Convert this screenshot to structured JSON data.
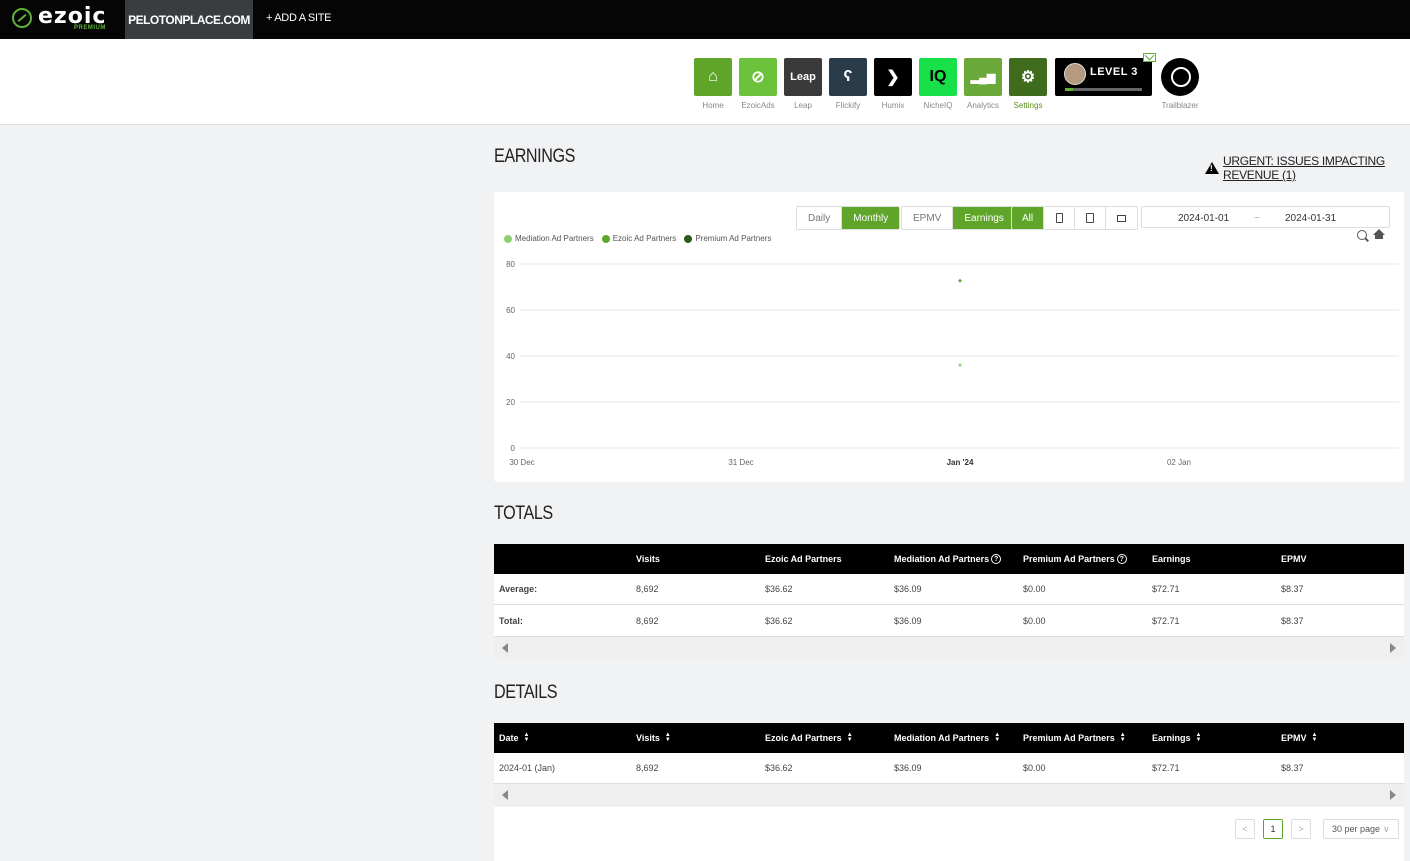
{
  "topbar": {
    "logo_text": "ezoic",
    "logo_sub": "PREMIUM",
    "site_name": "PELOTONPLACE.COM",
    "add_site": "+ ADD A SITE"
  },
  "apps": [
    {
      "label": "Home",
      "icon": "home-icon",
      "color": "#5fa52a",
      "glyph": "⌂"
    },
    {
      "label": "EzoicAds",
      "icon": "ezoicads-icon",
      "color": "#6cc23a",
      "glyph": "⊘"
    },
    {
      "label": "Leap",
      "icon": "leap-icon",
      "color": "#3a3a3a",
      "glyph": "Leap"
    },
    {
      "label": "Flickify",
      "icon": "flickify-icon",
      "color": "#2a3b4a",
      "glyph": "ʕ"
    },
    {
      "label": "Humix",
      "icon": "humix-icon",
      "color": "#000000",
      "glyph": "❯"
    },
    {
      "label": "NicheIQ",
      "icon": "nicheiq-icon",
      "color": "#18e048",
      "glyph": "IQ"
    },
    {
      "label": "Analytics",
      "icon": "analytics-icon",
      "color": "#6aa83a",
      "glyph": "▂▄▆"
    },
    {
      "label": "Settings",
      "icon": "gear-icon",
      "color": "#3f6b1c",
      "glyph": "⚙"
    }
  ],
  "level": {
    "label": "LEVEL 3",
    "progress": 0.1
  },
  "trailblazer_label": "Trailblazer",
  "earnings": {
    "title": "EARNINGS",
    "urgent_link": "URGENT: ISSUES IMPACTING REVENUE (1)",
    "toggle_period": [
      "Daily",
      "Monthly"
    ],
    "toggle_metric": [
      "EPMV",
      "Earnings"
    ],
    "device_all": "All",
    "date_from": "2024-01-01",
    "date_sep": "~",
    "date_to": "2024-01-31",
    "legend": [
      {
        "name": "Mediation Ad Partners",
        "color": "#8fcf72"
      },
      {
        "name": "Ezoic Ad Partners",
        "color": "#5fa52a"
      },
      {
        "name": "Premium Ad Partners",
        "color": "#2d5a16"
      }
    ]
  },
  "chart_data": {
    "type": "scatter",
    "title": "",
    "x_ticks": [
      "30 Dec",
      "31 Dec",
      "Jan '24",
      "02 Jan"
    ],
    "y_ticks": [
      0,
      20,
      40,
      60,
      80
    ],
    "ylim": [
      0,
      80
    ],
    "grid": true,
    "legend_position": "top-left",
    "series": [
      {
        "name": "Mediation Ad Partners",
        "color": "#8fcf72",
        "points": [
          {
            "x": "Jan '24",
            "y": 36.09
          }
        ]
      },
      {
        "name": "Ezoic Ad Partners",
        "color": "#5fa52a",
        "points": [
          {
            "x": "Jan '24",
            "y": 72.71
          }
        ]
      },
      {
        "name": "Premium Ad Partners",
        "color": "#2d5a16",
        "points": [
          {
            "x": "Jan '24",
            "y": 0
          }
        ]
      }
    ]
  },
  "totals": {
    "title": "TOTALS",
    "headers": [
      "",
      "Visits",
      "Ezoic Ad Partners",
      "Mediation Ad Partners",
      "Premium Ad Partners",
      "Earnings",
      "EPMV"
    ],
    "rows": [
      [
        "Average:",
        "8,692",
        "$36.62",
        "$36.09",
        "$0.00",
        "$72.71",
        "$8.37"
      ],
      [
        "Total:",
        "8,692",
        "$36.62",
        "$36.09",
        "$0.00",
        "$72.71",
        "$8.37"
      ]
    ]
  },
  "details": {
    "title": "DETAILS",
    "headers": [
      "Date",
      "Visits",
      "Ezoic Ad Partners",
      "Mediation Ad Partners",
      "Premium Ad Partners",
      "Earnings",
      "EPMV"
    ],
    "rows": [
      [
        "2024-01 (Jan)",
        "8,692",
        "$36.62",
        "$36.09",
        "$0.00",
        "$72.71",
        "$8.37"
      ]
    ],
    "page": "1",
    "per_page": "30 per page"
  }
}
